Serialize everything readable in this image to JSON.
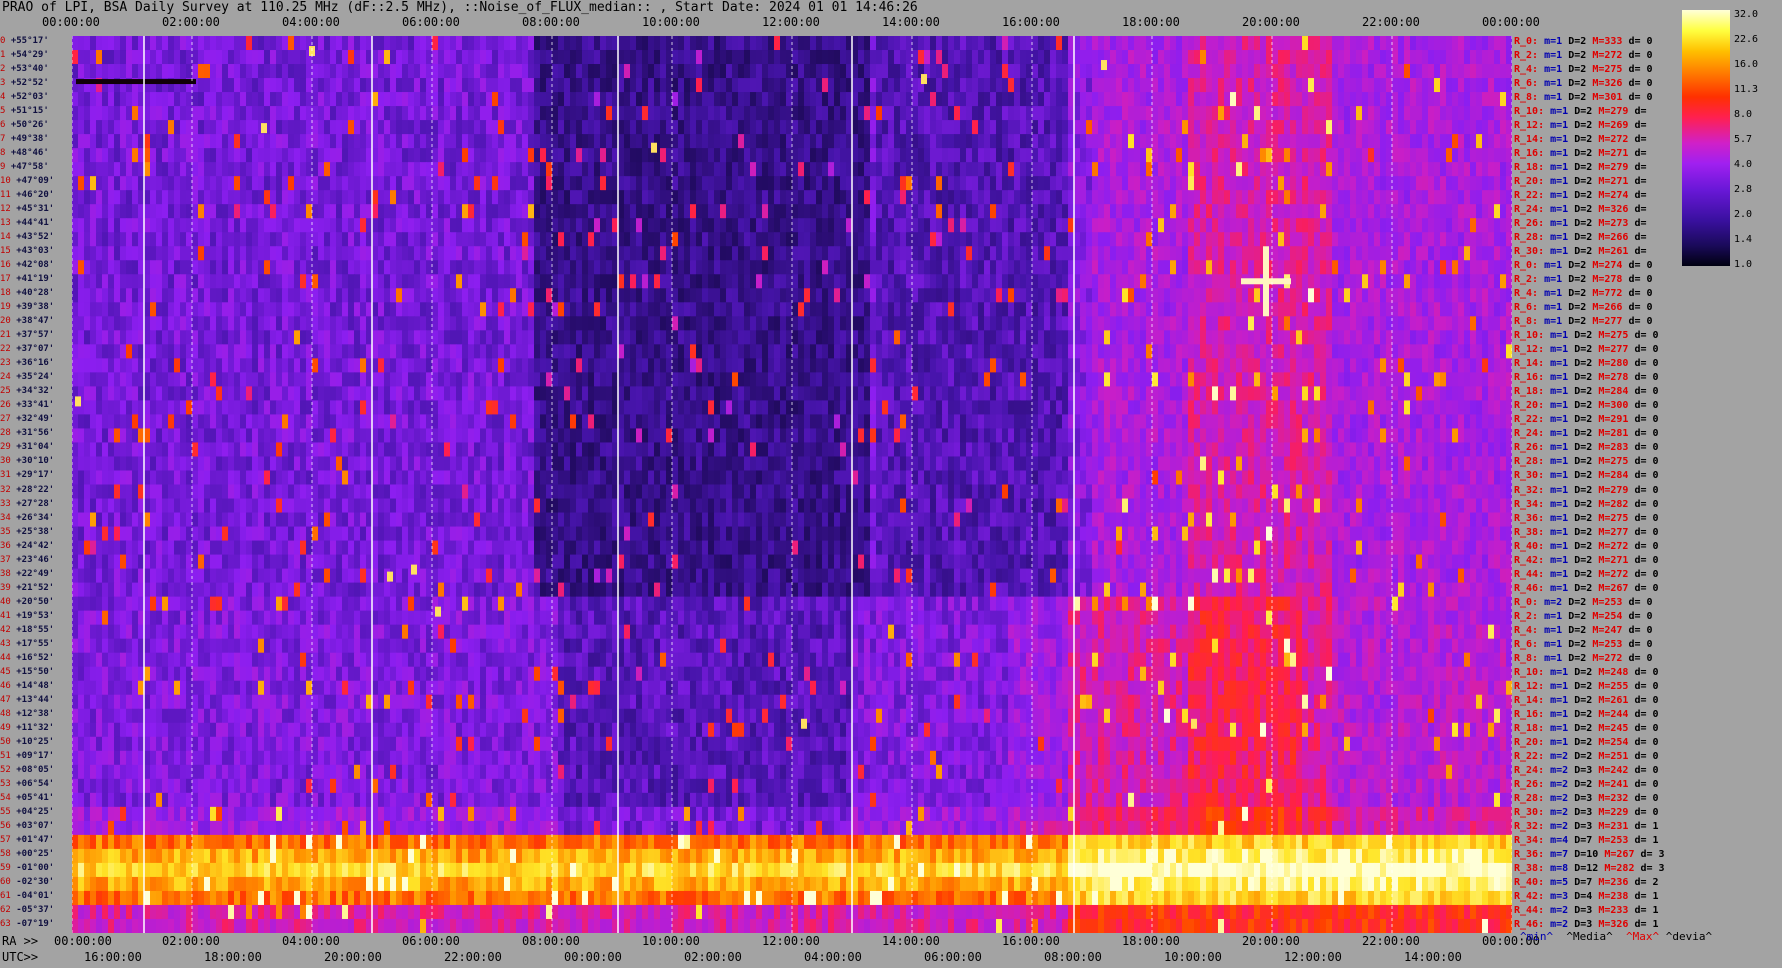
{
  "title": "PRAO of LPI, BSA Daily Survey at 110.25 MHz (dF::2.5 MHz), ::Noise_of_FLUX_median:: , Start Date: 2024 01 01 14:46:26",
  "top_axis_labels": [
    "00:00:00",
    "02:00:00",
    "04:00:00",
    "06:00:00",
    "08:00:00",
    "10:00:00",
    "12:00:00",
    "14:00:00",
    "16:00:00",
    "18:00:00",
    "20:00:00",
    "22:00:00",
    "00:00:00"
  ],
  "ra_prefix": "RA >>",
  "ra_labels": [
    "00:00:00",
    "02:00:00",
    "04:00:00",
    "06:00:00",
    "08:00:00",
    "10:00:00",
    "12:00:00",
    "14:00:00",
    "16:00:00",
    "18:00:00",
    "20:00:00",
    "22:00:00",
    "00:00:00"
  ],
  "utc_prefix": "UTC>>",
  "utc_labels": [
    "16:00:00",
    "18:00:00",
    "20:00:00",
    "22:00:00",
    "00:00:00",
    "02:00:00",
    "04:00:00",
    "06:00:00",
    "08:00:00",
    "10:00:00",
    "12:00:00",
    "14:00:00"
  ],
  "dec_labels": [
    {
      "row": "0",
      "dec": "+55°17'"
    },
    {
      "row": "1",
      "dec": "+54°29'"
    },
    {
      "row": "2",
      "dec": "+53°40'"
    },
    {
      "row": "3",
      "dec": "+52°52'"
    },
    {
      "row": "4",
      "dec": "+52°03'"
    },
    {
      "row": "5",
      "dec": "+51°15'"
    },
    {
      "row": "6",
      "dec": "+50°26'"
    },
    {
      "row": "7",
      "dec": "+49°38'"
    },
    {
      "row": "8",
      "dec": "+48°46'"
    },
    {
      "row": "9",
      "dec": "+47°58'"
    },
    {
      "row": "10",
      "dec": "+47°09'"
    },
    {
      "row": "11",
      "dec": "+46°20'"
    },
    {
      "row": "12",
      "dec": "+45°31'"
    },
    {
      "row": "13",
      "dec": "+44°41'"
    },
    {
      "row": "14",
      "dec": "+43°52'"
    },
    {
      "row": "15",
      "dec": "+43°03'"
    },
    {
      "row": "16",
      "dec": "+42°08'"
    },
    {
      "row": "17",
      "dec": "+41°19'"
    },
    {
      "row": "18",
      "dec": "+40°28'"
    },
    {
      "row": "19",
      "dec": "+39°38'"
    },
    {
      "row": "20",
      "dec": "+38°47'"
    },
    {
      "row": "21",
      "dec": "+37°57'"
    },
    {
      "row": "22",
      "dec": "+37°07'"
    },
    {
      "row": "23",
      "dec": "+36°16'"
    },
    {
      "row": "24",
      "dec": "+35°24'"
    },
    {
      "row": "25",
      "dec": "+34°32'"
    },
    {
      "row": "26",
      "dec": "+33°41'"
    },
    {
      "row": "27",
      "dec": "+32°49'"
    },
    {
      "row": "28",
      "dec": "+31°56'"
    },
    {
      "row": "29",
      "dec": "+31°04'"
    },
    {
      "row": "30",
      "dec": "+30°10'"
    },
    {
      "row": "31",
      "dec": "+29°17'"
    },
    {
      "row": "32",
      "dec": "+28°22'"
    },
    {
      "row": "33",
      "dec": "+27°28'"
    },
    {
      "row": "34",
      "dec": "+26°34'"
    },
    {
      "row": "35",
      "dec": "+25°38'"
    },
    {
      "row": "36",
      "dec": "+24°42'"
    },
    {
      "row": "37",
      "dec": "+23°46'"
    },
    {
      "row": "38",
      "dec": "+22°49'"
    },
    {
      "row": "39",
      "dec": "+21°52'"
    },
    {
      "row": "40",
      "dec": "+20°50'"
    },
    {
      "row": "41",
      "dec": "+19°53'"
    },
    {
      "row": "42",
      "dec": "+18°55'"
    },
    {
      "row": "43",
      "dec": "+17°55'"
    },
    {
      "row": "44",
      "dec": "+16°52'"
    },
    {
      "row": "45",
      "dec": "+15°50'"
    },
    {
      "row": "46",
      "dec": "+14°48'"
    },
    {
      "row": "47",
      "dec": "+13°44'"
    },
    {
      "row": "48",
      "dec": "+12°38'"
    },
    {
      "row": "49",
      "dec": "+11°32'"
    },
    {
      "row": "50",
      "dec": "+10°25'"
    },
    {
      "row": "51",
      "dec": "+09°17'"
    },
    {
      "row": "52",
      "dec": "+08°05'"
    },
    {
      "row": "53",
      "dec": "+06°54'"
    },
    {
      "row": "54",
      "dec": "+05°41'"
    },
    {
      "row": "55",
      "dec": "+04°25'"
    },
    {
      "row": "56",
      "dec": "+03°07'"
    },
    {
      "row": "57",
      "dec": "+01°47'"
    },
    {
      "row": "58",
      "dec": "+00°25'"
    },
    {
      "row": "59",
      "dec": "-01°00'"
    },
    {
      "row": "60",
      "dec": "-02°30'"
    },
    {
      "row": "61",
      "dec": "-04°01'"
    },
    {
      "row": "62",
      "dec": "-05°37'"
    },
    {
      "row": "63",
      "dec": "-07°19'"
    }
  ],
  "stats_rows": [
    {
      "r": "R_0:",
      "m": "m=1",
      "d": "D=2",
      "M": "M=333",
      "dev": "d= 0"
    },
    {
      "r": "R_2:",
      "m": "m=1",
      "d": "D=2",
      "M": "M=272",
      "dev": "d= 0"
    },
    {
      "r": "R_4:",
      "m": "m=1",
      "d": "D=2",
      "M": "M=275",
      "dev": "d= 0"
    },
    {
      "r": "R_6:",
      "m": "m=1",
      "d": "D=2",
      "M": "M=326",
      "dev": "d= 0"
    },
    {
      "r": "R_8:",
      "m": "m=1",
      "d": "D=2",
      "M": "M=301",
      "dev": "d= 0"
    },
    {
      "r": "R_10:",
      "m": "m=1",
      "d": "D=2",
      "M": "M=279",
      "dev": "d="
    },
    {
      "r": "R_12:",
      "m": "m=1",
      "d": "D=2",
      "M": "M=269",
      "dev": "d="
    },
    {
      "r": "R_14:",
      "m": "m=1",
      "d": "D=2",
      "M": "M=272",
      "dev": "d="
    },
    {
      "r": "R_16:",
      "m": "m=1",
      "d": "D=2",
      "M": "M=271",
      "dev": "d="
    },
    {
      "r": "R_18:",
      "m": "m=1",
      "d": "D=2",
      "M": "M=279",
      "dev": "d="
    },
    {
      "r": "R_20:",
      "m": "m=1",
      "d": "D=2",
      "M": "M=271",
      "dev": "d="
    },
    {
      "r": "R_22:",
      "m": "m=1",
      "d": "D=2",
      "M": "M=274",
      "dev": "d="
    },
    {
      "r": "R_24:",
      "m": "m=1",
      "d": "D=2",
      "M": "M=326",
      "dev": "d="
    },
    {
      "r": "R_26:",
      "m": "m=1",
      "d": "D=2",
      "M": "M=273",
      "dev": "d="
    },
    {
      "r": "R_28:",
      "m": "m=1",
      "d": "D=2",
      "M": "M=266",
      "dev": "d="
    },
    {
      "r": "R_30:",
      "m": "m=1",
      "d": "D=2",
      "M": "M=261",
      "dev": "d="
    },
    {
      "r": "R_0:",
      "m": "m=1",
      "d": "D=2",
      "M": "M=274",
      "dev": "d= 0"
    },
    {
      "r": "R_2:",
      "m": "m=1",
      "d": "D=2",
      "M": "M=278",
      "dev": "d= 0"
    },
    {
      "r": "R_4:",
      "m": "m=1",
      "d": "D=2",
      "M": "M=772",
      "dev": "d= 0"
    },
    {
      "r": "R_6:",
      "m": "m=1",
      "d": "D=2",
      "M": "M=266",
      "dev": "d= 0"
    },
    {
      "r": "R_8:",
      "m": "m=1",
      "d": "D=2",
      "M": "M=277",
      "dev": "d= 0"
    },
    {
      "r": "R_10:",
      "m": "m=1",
      "d": "D=2",
      "M": "M=275",
      "dev": "d= 0"
    },
    {
      "r": "R_12:",
      "m": "m=1",
      "d": "D=2",
      "M": "M=277",
      "dev": "d= 0"
    },
    {
      "r": "R_14:",
      "m": "m=1",
      "d": "D=2",
      "M": "M=280",
      "dev": "d= 0"
    },
    {
      "r": "R_16:",
      "m": "m=1",
      "d": "D=2",
      "M": "M=278",
      "dev": "d= 0"
    },
    {
      "r": "R_18:",
      "m": "m=1",
      "d": "D=2",
      "M": "M=284",
      "dev": "d= 0"
    },
    {
      "r": "R_20:",
      "m": "m=1",
      "d": "D=2",
      "M": "M=300",
      "dev": "d= 0"
    },
    {
      "r": "R_22:",
      "m": "m=1",
      "d": "D=2",
      "M": "M=291",
      "dev": "d= 0"
    },
    {
      "r": "R_24:",
      "m": "m=1",
      "d": "D=2",
      "M": "M=281",
      "dev": "d= 0"
    },
    {
      "r": "R_26:",
      "m": "m=1",
      "d": "D=2",
      "M": "M=283",
      "dev": "d= 0"
    },
    {
      "r": "R_28:",
      "m": "m=1",
      "d": "D=2",
      "M": "M=275",
      "dev": "d= 0"
    },
    {
      "r": "R_30:",
      "m": "m=1",
      "d": "D=2",
      "M": "M=284",
      "dev": "d= 0"
    },
    {
      "r": "R_32:",
      "m": "m=1",
      "d": "D=2",
      "M": "M=279",
      "dev": "d= 0"
    },
    {
      "r": "R_34:",
      "m": "m=1",
      "d": "D=2",
      "M": "M=282",
      "dev": "d= 0"
    },
    {
      "r": "R_36:",
      "m": "m=1",
      "d": "D=2",
      "M": "M=275",
      "dev": "d= 0"
    },
    {
      "r": "R_38:",
      "m": "m=1",
      "d": "D=2",
      "M": "M=277",
      "dev": "d= 0"
    },
    {
      "r": "R_40:",
      "m": "m=1",
      "d": "D=2",
      "M": "M=272",
      "dev": "d= 0"
    },
    {
      "r": "R_42:",
      "m": "m=1",
      "d": "D=2",
      "M": "M=271",
      "dev": "d= 0"
    },
    {
      "r": "R_44:",
      "m": "m=1",
      "d": "D=2",
      "M": "M=272",
      "dev": "d= 0"
    },
    {
      "r": "R_46:",
      "m": "m=1",
      "d": "D=2",
      "M": "M=267",
      "dev": "d= 0"
    },
    {
      "r": "R_0:",
      "m": "m=2",
      "d": "D=2",
      "M": "M=253",
      "dev": "d= 0"
    },
    {
      "r": "R_2:",
      "m": "m=1",
      "d": "D=2",
      "M": "M=254",
      "dev": "d= 0"
    },
    {
      "r": "R_4:",
      "m": "m=1",
      "d": "D=2",
      "M": "M=247",
      "dev": "d= 0"
    },
    {
      "r": "R_6:",
      "m": "m=1",
      "d": "D=2",
      "M": "M=253",
      "dev": "d= 0"
    },
    {
      "r": "R_8:",
      "m": "m=1",
      "d": "D=2",
      "M": "M=272",
      "dev": "d= 0"
    },
    {
      "r": "R_10:",
      "m": "m=1",
      "d": "D=2",
      "M": "M=248",
      "dev": "d= 0"
    },
    {
      "r": "R_12:",
      "m": "m=1",
      "d": "D=2",
      "M": "M=255",
      "dev": "d= 0"
    },
    {
      "r": "R_14:",
      "m": "m=1",
      "d": "D=2",
      "M": "M=261",
      "dev": "d= 0"
    },
    {
      "r": "R_16:",
      "m": "m=1",
      "d": "D=2",
      "M": "M=244",
      "dev": "d= 0"
    },
    {
      "r": "R_18:",
      "m": "m=1",
      "d": "D=2",
      "M": "M=245",
      "dev": "d= 0"
    },
    {
      "r": "R_20:",
      "m": "m=1",
      "d": "D=2",
      "M": "M=254",
      "dev": "d= 0"
    },
    {
      "r": "R_22:",
      "m": "m=2",
      "d": "D=2",
      "M": "M=251",
      "dev": "d= 0"
    },
    {
      "r": "R_24:",
      "m": "m=2",
      "d": "D=3",
      "M": "M=242",
      "dev": "d= 0"
    },
    {
      "r": "R_26:",
      "m": "m=2",
      "d": "D=2",
      "M": "M=241",
      "dev": "d= 0"
    },
    {
      "r": "R_28:",
      "m": "m=2",
      "d": "D=3",
      "M": "M=232",
      "dev": "d= 0"
    },
    {
      "r": "R_30:",
      "m": "m=2",
      "d": "D=3",
      "M": "M=229",
      "dev": "d= 0"
    },
    {
      "r": "R_32:",
      "m": "m=2",
      "d": "D=3",
      "M": "M=231",
      "dev": "d= 1"
    },
    {
      "r": "R_34:",
      "m": "m=4",
      "d": "D=7",
      "M": "M=253",
      "dev": "d= 1"
    },
    {
      "r": "R_36:",
      "m": "m=7",
      "d": "D=10",
      "M": "M=267",
      "dev": "d= 3"
    },
    {
      "r": "R_38:",
      "m": "m=8",
      "d": "D=12",
      "M": "M=282",
      "dev": "d= 3"
    },
    {
      "r": "R_40:",
      "m": "m=5",
      "d": "D=7",
      "M": "M=236",
      "dev": "d= 2"
    },
    {
      "r": "R_42:",
      "m": "m=3",
      "d": "D=4",
      "M": "M=238",
      "dev": "d= 1"
    },
    {
      "r": "R_44:",
      "m": "m=2",
      "d": "D=3",
      "M": "M=233",
      "dev": "d= 1"
    },
    {
      "r": "R_46:",
      "m": "m=2",
      "d": "D=3",
      "M": "M=326",
      "dev": "d= 1"
    }
  ],
  "footer_legend": {
    "min": "^min^",
    "media": "^Media^",
    "max": "^Max^",
    "devia": "^devia^"
  },
  "colorbar": {
    "labels": [
      "32.0",
      "22.6",
      "16.0",
      "11.3",
      "8.0",
      "5.7",
      "4.0",
      "2.8",
      "2.0",
      "1.4",
      "1.0"
    ],
    "colors": [
      "#000010",
      "#3a10a0",
      "#a020f0",
      "#ff2050",
      "#ff8000",
      "#ffff40",
      "#ffffd8"
    ]
  },
  "chart_data": {
    "type": "heatmap",
    "title": "PRAO of LPI, BSA Daily Survey at 110.25 MHz (dF::2.5 MHz), ::Noise_of_FLUX_median:: , Start Date: 2024 01 01 14:46:26",
    "x_axis": "RA (hours) / UTC",
    "x_range_hours": [
      0,
      24
    ],
    "y_axis": "Declination rows 0–63",
    "rows": 64,
    "colorscale_range": [
      1.0,
      32.0
    ],
    "features": [
      {
        "kind": "bright_band",
        "rows": [
          57,
          61
        ],
        "ra_hours": [
          0,
          24
        ],
        "level": "high"
      },
      {
        "kind": "point_source",
        "ra_hours": 19.9,
        "row": 17,
        "level": "max"
      },
      {
        "kind": "enhanced_region",
        "ra_hours": [
          17,
          24
        ],
        "rows": [
          0,
          63
        ],
        "level": "medium"
      },
      {
        "kind": "dark_region",
        "ra_hours": [
          8,
          13
        ],
        "rows": [
          0,
          39
        ],
        "level": "low"
      }
    ]
  }
}
